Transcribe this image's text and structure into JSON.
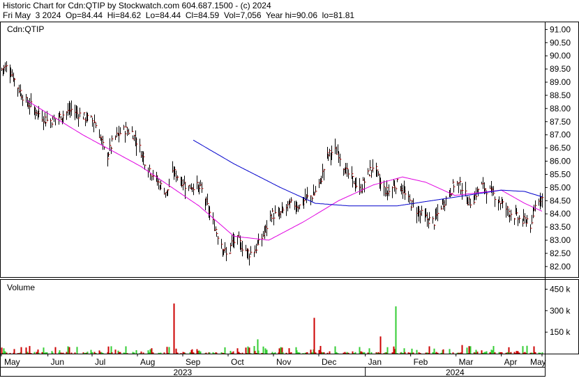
{
  "header": {
    "line1": "Historic Chart for Cdn:QTIP by Stockwatch.com 604.687.1500 - (c) 2024",
    "line2": "Fri May  3 2024  Op=84.44  Hi=84.62  Lo=84.44  Cl=84.59  Vol=7,056  Year hi=90.06  lo=81.81"
  },
  "chart_data": {
    "type": "bar",
    "symbol_label": "Cdn:QTIP",
    "volume_label": "Volume",
    "price_ticks": [
      "91.00",
      "90.50",
      "90.00",
      "89.50",
      "89.00",
      "88.50",
      "88.00",
      "87.50",
      "87.00",
      "86.50",
      "86.00",
      "85.50",
      "85.00",
      "84.50",
      "84.00",
      "83.50",
      "83.00",
      "82.50",
      "82.00"
    ],
    "price_tick_values": [
      91.0,
      90.5,
      90.0,
      89.5,
      89.0,
      88.5,
      88.0,
      87.5,
      87.0,
      86.5,
      86.0,
      85.5,
      85.0,
      84.5,
      84.0,
      83.5,
      83.0,
      82.5,
      82.0
    ],
    "ylim": [
      81.6,
      91.3
    ],
    "volume_ticks": [
      "450 k",
      "300 k",
      "150 k"
    ],
    "volume_tick_values": [
      450000,
      300000,
      150000
    ],
    "volume_ylim": [
      0,
      520000
    ],
    "months": [
      "May",
      "Jun",
      "Jul",
      "Aug",
      "Sep",
      "Oct",
      "Nov",
      "Dec",
      "Jan",
      "Feb",
      "Mar",
      "Apr",
      "May"
    ],
    "years": [
      "2023",
      "2024"
    ],
    "close_anchors": [
      [
        0,
        89.5
      ],
      [
        6,
        89.6
      ],
      [
        12,
        89.0
      ],
      [
        20,
        88.3
      ],
      [
        30,
        87.9
      ],
      [
        40,
        87.5
      ],
      [
        50,
        87.7
      ],
      [
        60,
        87.95
      ],
      [
        70,
        87.7
      ],
      [
        80,
        87.5
      ],
      [
        85,
        86.9
      ],
      [
        90,
        86.1
      ],
      [
        96,
        86.8
      ],
      [
        100,
        87.0
      ],
      [
        106,
        87.2
      ],
      [
        112,
        87.1
      ],
      [
        118,
        86.6
      ],
      [
        124,
        85.9
      ],
      [
        130,
        85.5
      ],
      [
        136,
        85.1
      ],
      [
        142,
        84.8
      ],
      [
        148,
        85.6
      ],
      [
        154,
        85.3
      ],
      [
        160,
        85.0
      ],
      [
        166,
        85.1
      ],
      [
        172,
        84.9
      ],
      [
        176,
        84.4
      ],
      [
        180,
        83.9
      ],
      [
        185,
        83.3
      ],
      [
        190,
        82.8
      ],
      [
        194,
        82.3
      ],
      [
        198,
        82.9
      ],
      [
        203,
        83.0
      ],
      [
        208,
        82.7
      ],
      [
        213,
        82.5
      ],
      [
        217,
        82.6
      ],
      [
        222,
        82.9
      ],
      [
        227,
        83.4
      ],
      [
        232,
        84.0
      ],
      [
        238,
        83.9
      ],
      [
        244,
        84.2
      ],
      [
        250,
        84.4
      ],
      [
        256,
        84.3
      ],
      [
        262,
        84.6
      ],
      [
        268,
        84.7
      ],
      [
        274,
        85.2
      ],
      [
        280,
        86.2
      ],
      [
        286,
        86.4
      ],
      [
        290,
        86.3
      ],
      [
        296,
        85.6
      ],
      [
        302,
        85.3
      ],
      [
        308,
        84.9
      ],
      [
        314,
        85.4
      ],
      [
        320,
        85.9
      ],
      [
        326,
        85.1
      ],
      [
        332,
        84.8
      ],
      [
        338,
        85.1
      ],
      [
        342,
        85.2
      ],
      [
        348,
        84.6
      ],
      [
        354,
        84.3
      ],
      [
        360,
        84.0
      ],
      [
        366,
        83.8
      ],
      [
        372,
        83.7
      ],
      [
        378,
        84.3
      ],
      [
        384,
        84.7
      ],
      [
        390,
        85.2
      ],
      [
        396,
        85.0
      ],
      [
        402,
        84.4
      ],
      [
        406,
        84.6
      ],
      [
        412,
        85.1
      ],
      [
        418,
        84.9
      ],
      [
        424,
        84.7
      ],
      [
        430,
        84.4
      ],
      [
        436,
        84.1
      ],
      [
        442,
        83.9
      ],
      [
        448,
        83.7
      ],
      [
        452,
        83.8
      ],
      [
        456,
        83.5
      ],
      [
        458,
        84.2
      ],
      [
        462,
        84.6
      ],
      [
        465,
        84.59
      ]
    ],
    "ma_fast_anchors": [
      [
        22,
        88.3
      ],
      [
        70,
        87.0
      ],
      [
        120,
        85.8
      ],
      [
        170,
        84.3
      ],
      [
        200,
        83.15
      ],
      [
        230,
        83.0
      ],
      [
        260,
        83.7
      ],
      [
        290,
        84.5
      ],
      [
        320,
        85.1
      ],
      [
        345,
        85.4
      ],
      [
        365,
        85.2
      ],
      [
        390,
        84.7
      ],
      [
        410,
        84.8
      ],
      [
        430,
        84.9
      ],
      [
        450,
        84.4
      ],
      [
        465,
        84.1
      ]
    ],
    "ma_slow_anchors": [
      [
        165,
        86.8
      ],
      [
        200,
        85.9
      ],
      [
        240,
        85.0
      ],
      [
        270,
        84.4
      ],
      [
        300,
        84.3
      ],
      [
        340,
        84.3
      ],
      [
        370,
        84.5
      ],
      [
        400,
        84.7
      ],
      [
        430,
        84.9
      ],
      [
        450,
        84.85
      ],
      [
        465,
        84.65
      ]
    ],
    "volume_spikes": [
      [
        148,
        350000
      ],
      [
        269,
        250000
      ],
      [
        285,
        150000
      ],
      [
        339,
        330000
      ],
      [
        326,
        120000
      ],
      [
        220,
        100000
      ],
      [
        396,
        60000
      ],
      [
        452,
        55000
      ]
    ]
  }
}
